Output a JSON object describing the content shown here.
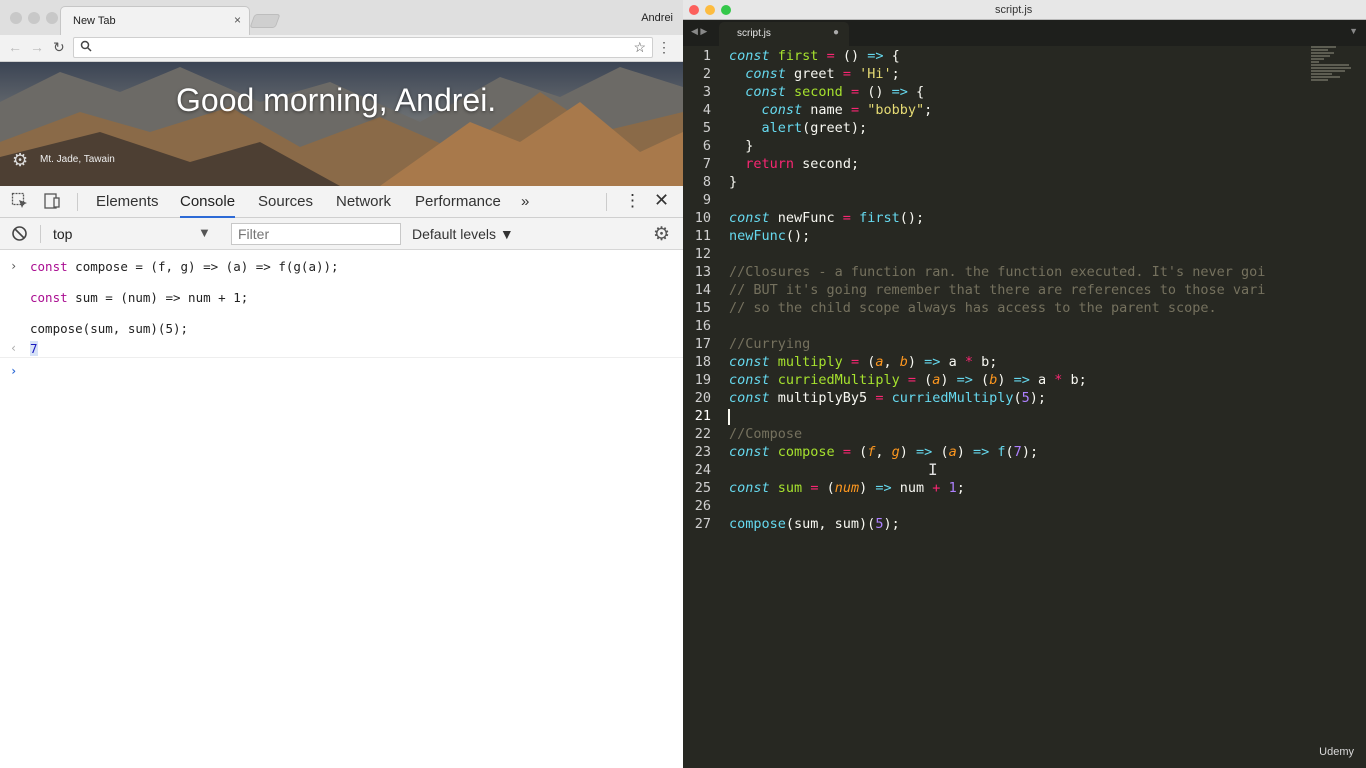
{
  "browser": {
    "tab_title": "New Tab",
    "tab_close": "×",
    "profile": "Andrei",
    "greeting": "Good morning, Andrei.",
    "location": "Mt. Jade, Tawain"
  },
  "devtools": {
    "tabs": [
      "Elements",
      "Console",
      "Sources",
      "Network",
      "Performance"
    ],
    "more": "»",
    "context": "top",
    "filter_placeholder": "Filter",
    "levels": "Default levels ▼"
  },
  "console": {
    "input_lines": [
      "const compose = (f, g) => (a) => f(g(a));",
      "const sum = (num) => num + 1;",
      "compose(sum, sum)(5);"
    ],
    "output": "7"
  },
  "editor": {
    "window_title": "script.js",
    "tab_label": "script.js",
    "watermark": "Udemy",
    "lines": [
      "1",
      "2",
      "3",
      "4",
      "5",
      "6",
      "7",
      "8",
      "9",
      "10",
      "11",
      "12",
      "13",
      "14",
      "15",
      "16",
      "17",
      "18",
      "19",
      "20",
      "21",
      "22",
      "23",
      "24",
      "25",
      "26",
      "27"
    ],
    "code_text": {
      "l13": "//Closures - a function ran. the function executed. It's never goi",
      "l14": "// BUT it's going remember that there are references to those vari",
      "l15": "// so the child scope always has access to the parent scope.",
      "l17": "//Currying",
      "l22": "//Compose"
    }
  },
  "colors": {
    "editor_bg": "#272822",
    "keyword": "#66d9ef",
    "function": "#a6e22e",
    "operator": "#f92672",
    "string": "#e6db74",
    "number": "#ae81ff",
    "param": "#fd971f",
    "comment": "#75715e",
    "devtools_active": "#2d6ad6"
  }
}
